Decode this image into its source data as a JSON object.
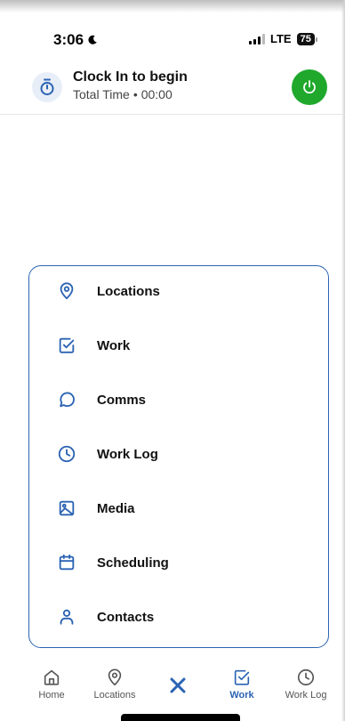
{
  "status_bar": {
    "time": "3:06",
    "network": "LTE",
    "battery": "75"
  },
  "clock": {
    "title": "Clock In to begin",
    "total_label": "Total Time",
    "separator": "•",
    "total_value": "00:00"
  },
  "menu": {
    "items": [
      {
        "label": "Locations",
        "icon": "location-pin-icon"
      },
      {
        "label": "Work",
        "icon": "checkbox-icon"
      },
      {
        "label": "Comms",
        "icon": "chat-bubble-icon"
      },
      {
        "label": "Work Log",
        "icon": "clock-icon"
      },
      {
        "label": "Media",
        "icon": "image-icon"
      },
      {
        "label": "Scheduling",
        "icon": "calendar-icon"
      },
      {
        "label": "Contacts",
        "icon": "person-icon"
      }
    ]
  },
  "bottom_nav": {
    "items": [
      {
        "label": "Home",
        "icon": "home-icon"
      },
      {
        "label": "Locations",
        "icon": "location-pin-icon"
      },
      {
        "label": "Work",
        "icon": "checkbox-icon",
        "active": true
      },
      {
        "label": "Work Log",
        "icon": "clock-icon"
      }
    ],
    "close_icon": "close-icon"
  },
  "colors": {
    "accent": "#2b63b3",
    "power": "#1fa82c",
    "icon_bg": "#e8eef8"
  }
}
